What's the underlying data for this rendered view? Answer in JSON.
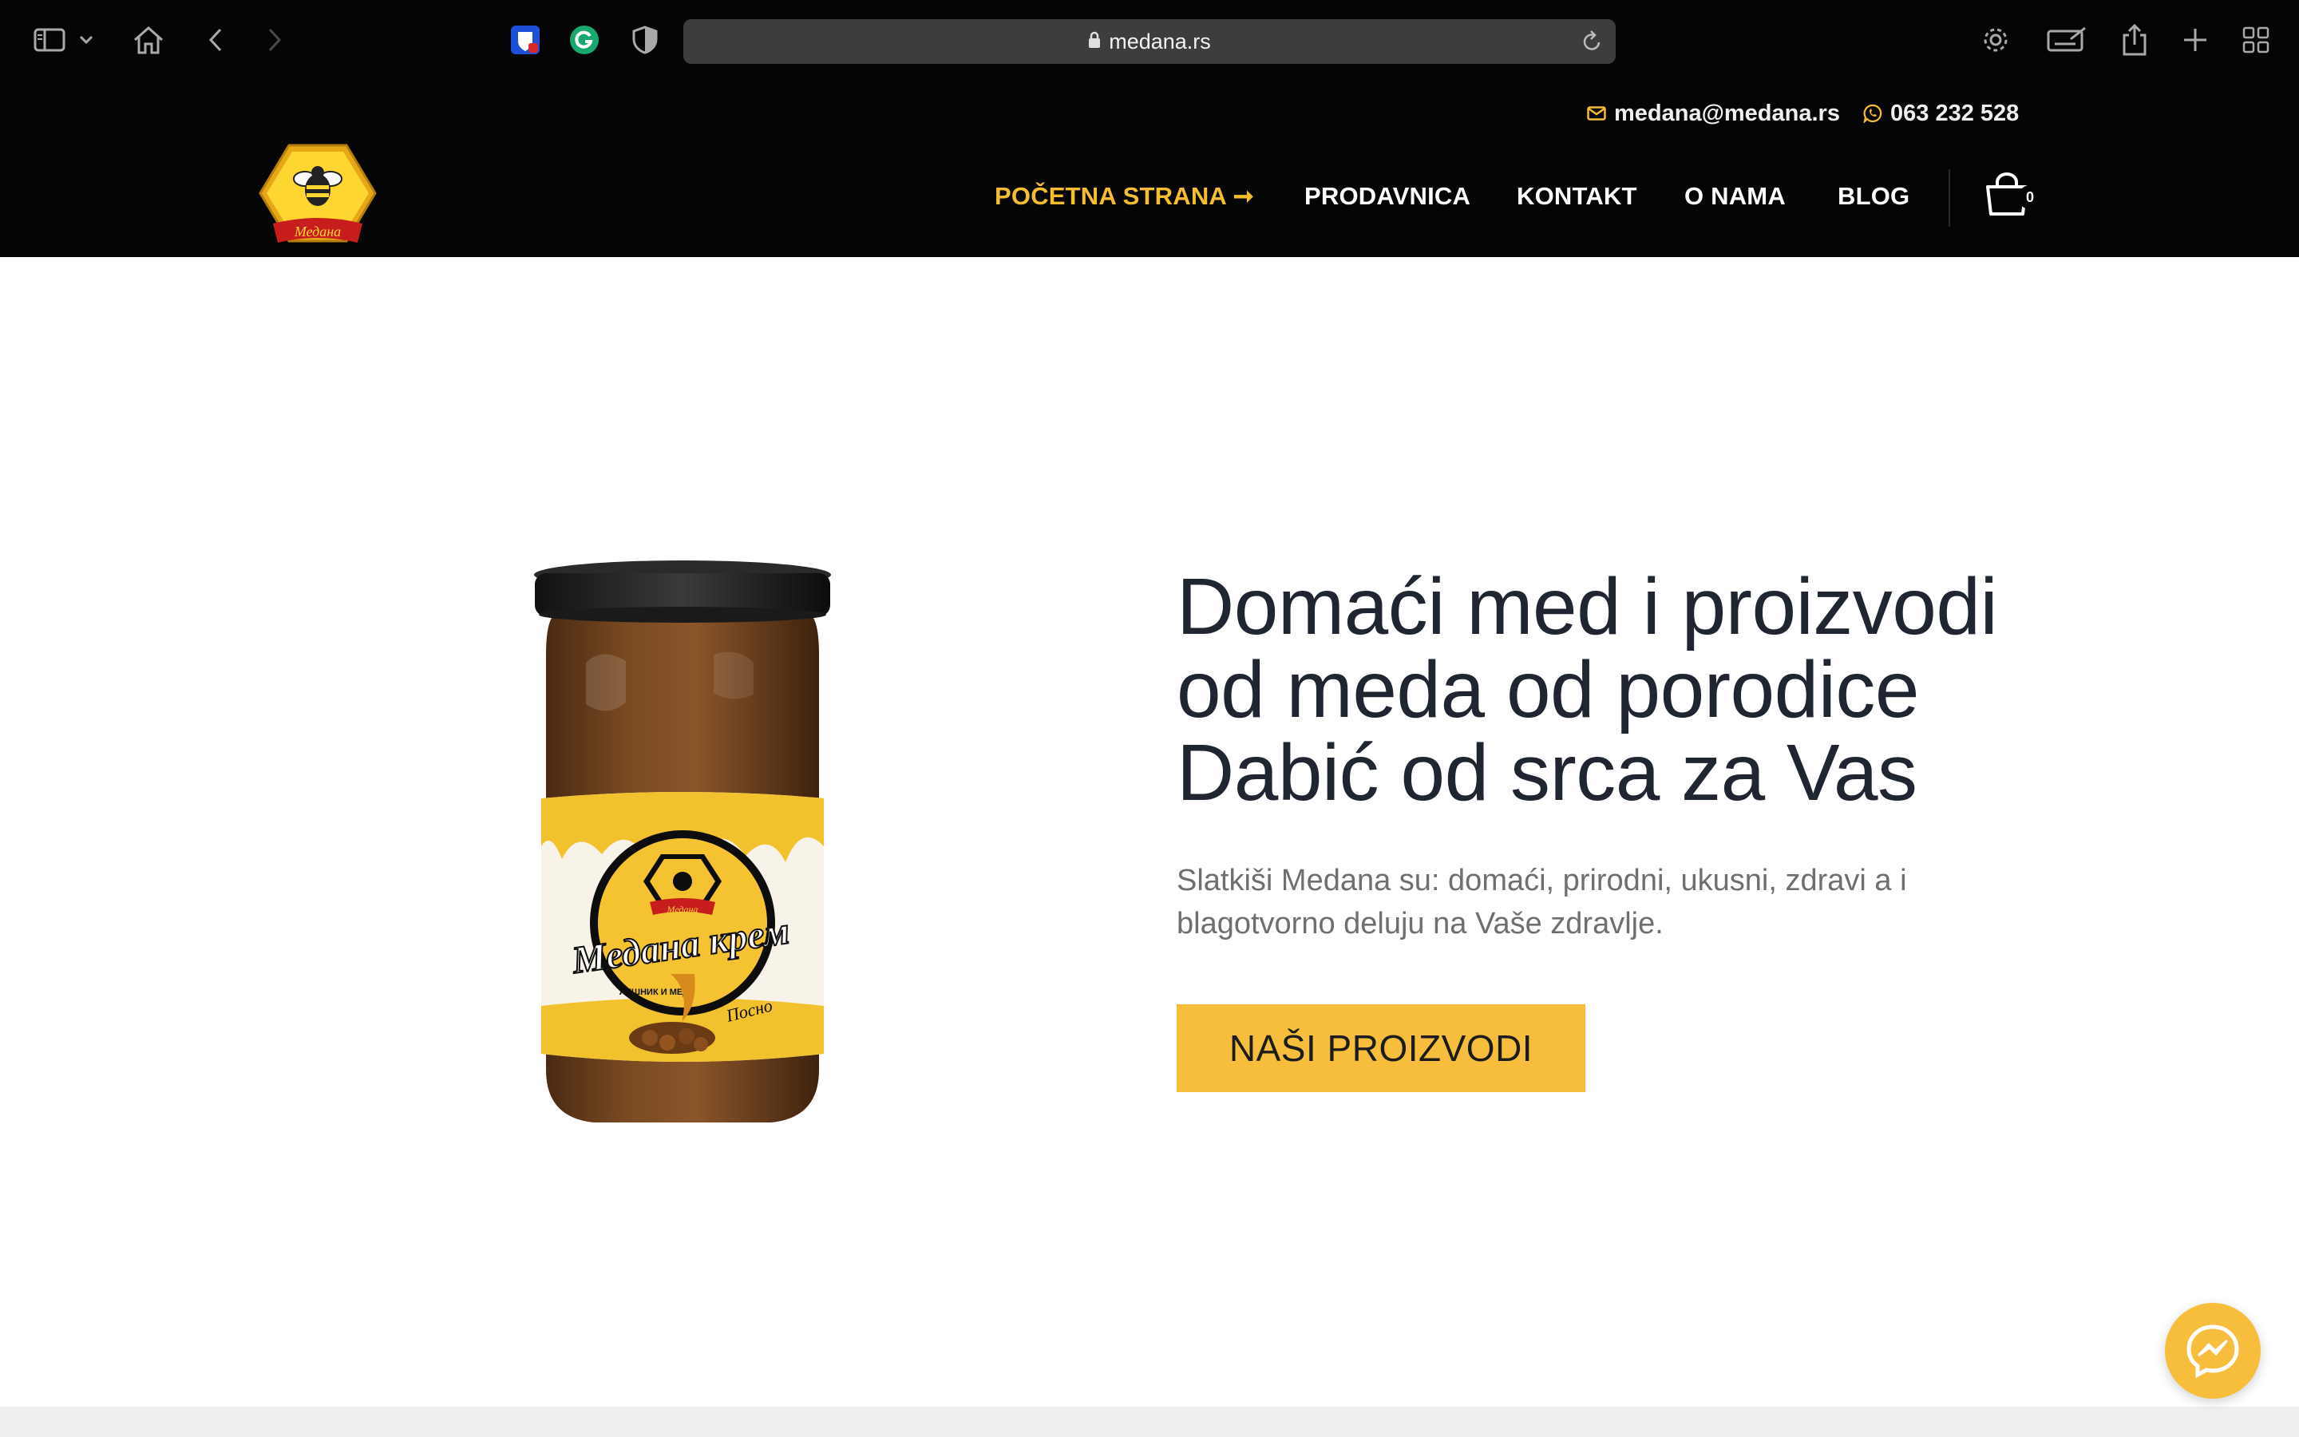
{
  "browser": {
    "url": "medana.rs",
    "icons": [
      "sidebar-icon",
      "chevron-down-icon",
      "home-icon",
      "back-icon",
      "forward-icon",
      "bitwarden-icon",
      "grammarly-icon",
      "privacy-shield-icon",
      "lock-icon",
      "reload-icon",
      "gear-icon",
      "keyboard-icon",
      "share-icon",
      "new-tab-icon",
      "tab-overview-icon"
    ]
  },
  "header": {
    "email": "medana@medana.rs",
    "phone": "063 232 528",
    "logo_text": "Медана",
    "nav": {
      "home": "POČETNA STRANA",
      "home_arrow": "➞",
      "shop": "PRODAVNICA",
      "contact": "KONTAKT",
      "about": "O NAMA",
      "blog": "BLOG"
    },
    "cart_count": "0"
  },
  "hero": {
    "title_lines": [
      "Domaći med i proizvodi",
      "od meda od porodice",
      "Dabić od srca za Vas"
    ],
    "text": "Slatkiši Medana su: domaći, prirodni, ukusni, zdravi a i blagotvorno deluju na Vaše zdravlje.",
    "button": "NAŠI PROIZVODI",
    "product_label": {
      "brand": "Медана",
      "name": "Медана крем",
      "ingredients": "ЛЕШНИК И МЕД",
      "variant": "Посно"
    }
  },
  "colors": {
    "accent": "#f6be3c",
    "header_bg": "#050505",
    "title": "#1f2531",
    "text": "#6f6f6f"
  }
}
